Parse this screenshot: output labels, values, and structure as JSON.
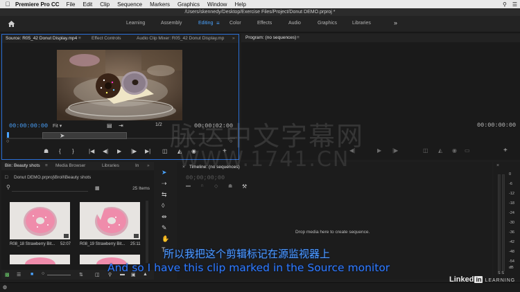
{
  "menubar": {
    "apple": "",
    "app": "Premiere Pro CC",
    "items": [
      "File",
      "Edit",
      "Clip",
      "Sequence",
      "Markers",
      "Graphics",
      "Window",
      "Help"
    ]
  },
  "window": {
    "title": "/Users/skennedy/Desktop/Exercise Files/Project/Donut DEMO.prproj *"
  },
  "workspaces": {
    "tabs": [
      "Learning",
      "Assembly",
      "Editing",
      "Color",
      "Audio",
      "Effects",
      "Graphics",
      "Libraries"
    ],
    "active": "Editing",
    "more": "»"
  },
  "source": {
    "tabs": [
      "Source: R05_42 Donut Display.mp4",
      "Effect Controls",
      "Audio Clip Mixer: R05_42 Donut Display.mp"
    ],
    "timecode_in": "00:00:00:00",
    "fit": "Fit",
    "resolution": "1/2",
    "timecode_out": "00:00:02:00"
  },
  "program": {
    "tab": "Program: (no sequences)",
    "timecode": "00:00:00:00"
  },
  "project": {
    "tabs": [
      "Bin: Beauty shots",
      "Media Browser",
      "Libraries",
      "In"
    ],
    "path": "Donut DEMO.prproj\\Broll\\Beauty shots",
    "items_count": "25 Items",
    "clips": [
      {
        "name": "R08_18 Strawberry Bit...",
        "duration": "52:07"
      },
      {
        "name": "R08_19 Strawberry Bit...",
        "duration": "25:11"
      }
    ]
  },
  "timeline": {
    "tab": "Timeline: (no sequences)",
    "timecode": "00;00;00;00",
    "drop_message": "Drop media here to create sequence."
  },
  "meter": {
    "labels": [
      "0",
      "-6",
      "-12",
      "-18",
      "-24",
      "-30",
      "-36",
      "-42",
      "-48",
      "-54",
      "dB"
    ],
    "solo": "S S"
  },
  "subtitles": {
    "cn": "所以我把这个剪辑标记在源监视器上",
    "en": "And so I have this clip marked in the Source monitor"
  },
  "watermark": {
    "cn": "脉达中文字幕网",
    "url": "WWW.1741.CN"
  },
  "brand": {
    "linked": "Linked",
    "in": "in",
    "learning": "LEARNING"
  },
  "colors": {
    "accent": "#4aa3ff",
    "selection_border": "#2a6fd6",
    "subtitle": "#2f7bff"
  }
}
